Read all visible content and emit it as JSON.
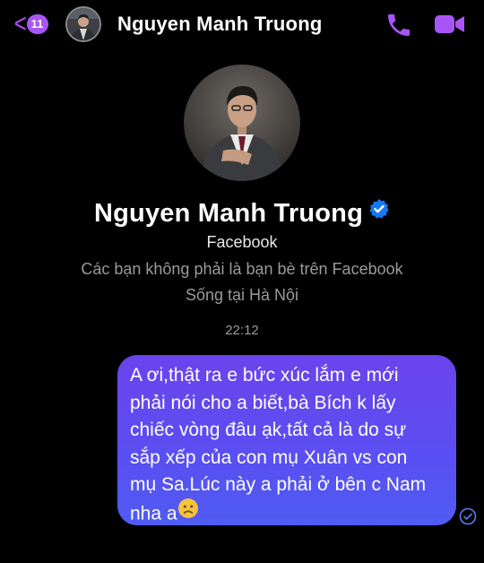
{
  "header": {
    "back_count": "11",
    "contact_name": "Nguyen Manh Truong",
    "accent_color": "#a855f7"
  },
  "profile": {
    "name": "Nguyen Manh Truong",
    "platform": "Facebook",
    "friend_note": "Các bạn không phải là bạn bè trên Facebook",
    "location": "Sống tại Hà Nội"
  },
  "timestamp": "22:12",
  "message": {
    "lines": [
      "A ơi,thật ra e bức xúc lắm e mới",
      "phải nói cho a biết,bà Bích k lấy",
      "chiếc vòng đâu ạk,tất cả là do sự",
      "sắp xếp của con mụ Xuân vs con",
      "mụ Sa.Lúc này a phải ở bên c Nam",
      "nha a"
    ],
    "emoji": "frowning-face",
    "bubble_color": "#5a4ff2"
  },
  "icons": [
    "back-chevron-icon",
    "phone-icon",
    "video-camera-icon",
    "verified-badge-icon",
    "seen-check-icon"
  ]
}
